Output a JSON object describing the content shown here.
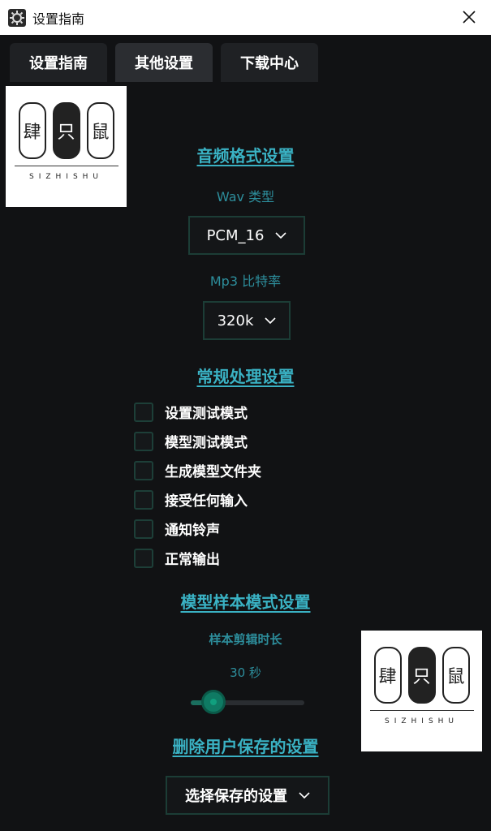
{
  "window": {
    "title": "设置指南",
    "app_icon": "gear-icon",
    "close_icon": "close-icon"
  },
  "tabs": [
    {
      "label": "设置指南",
      "active": false
    },
    {
      "label": "其他设置",
      "active": true
    },
    {
      "label": "下载中心",
      "active": false
    }
  ],
  "audio": {
    "section_title": "音频格式设置",
    "wav_label": "Wav 类型",
    "wav_value": "PCM_16",
    "mp3_label": "Mp3 比特率",
    "mp3_value": "320k"
  },
  "general": {
    "section_title": "常规处理设置",
    "options": [
      {
        "label": "设置测试模式",
        "checked": false
      },
      {
        "label": "模型测试模式",
        "checked": false
      },
      {
        "label": "生成模型文件夹",
        "checked": false
      },
      {
        "label": "接受任何输入",
        "checked": false
      },
      {
        "label": "通知铃声",
        "checked": false
      },
      {
        "label": "正常输出",
        "checked": false
      }
    ]
  },
  "sample": {
    "section_title": "模型样本模式设置",
    "duration_label": "样本剪辑时长",
    "duration_value": "30 秒",
    "slider_fraction": 0.2
  },
  "saved": {
    "section_title": "删除用户保存的设置",
    "select_value": "选择保存的设置"
  },
  "watermark_logo": {
    "glyphs": [
      "肆",
      "只",
      "鼠"
    ],
    "text": "SIZHISHU"
  },
  "colors": {
    "accent": "#3ab2c4",
    "label": "#2d8e9c",
    "slider_thumb": "#0f7a63",
    "background": "#111214"
  }
}
